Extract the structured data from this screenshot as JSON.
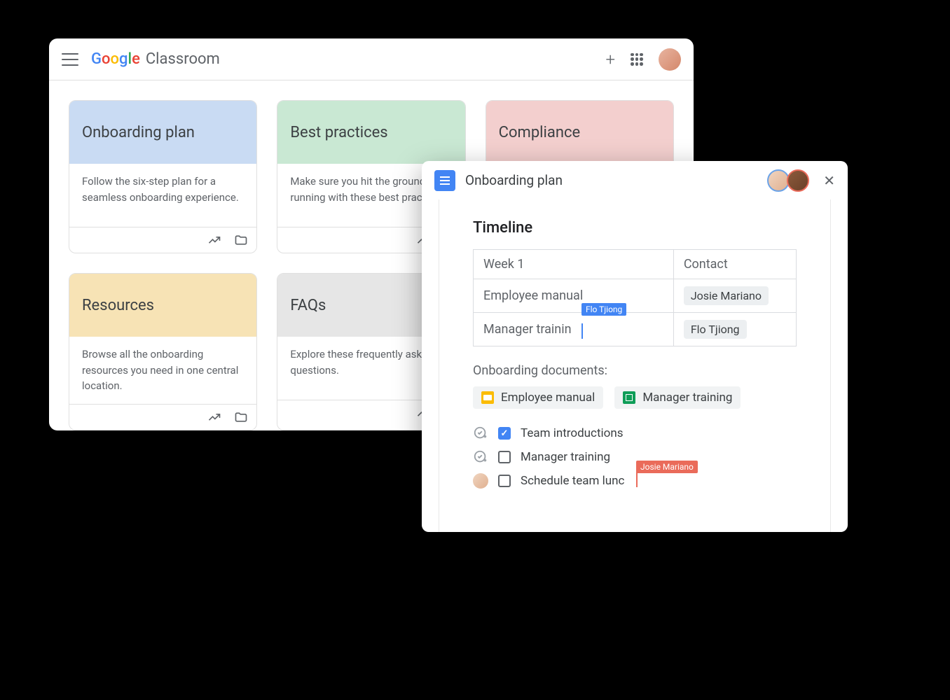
{
  "classroom": {
    "app_name": "Classroom",
    "cards": [
      {
        "title": "Onboarding plan",
        "desc": "Follow the six-step plan for a seamless onboarding experience.",
        "color": "c-blue"
      },
      {
        "title": "Best practices",
        "desc": "Make sure you hit the ground running with these best practices.",
        "color": "c-green"
      },
      {
        "title": "Compliance",
        "desc": "",
        "color": "c-pink"
      },
      {
        "title": "Resources",
        "desc": "Browse all the onboarding resources you need in one central location.",
        "color": "c-yellow"
      },
      {
        "title": "FAQs",
        "desc": "Explore these frequently asked questions.",
        "color": "c-gray"
      }
    ]
  },
  "docs": {
    "title": "Onboarding plan",
    "heading": "Timeline",
    "table": {
      "headers": [
        "Week 1",
        "Contact"
      ],
      "rows": [
        {
          "item": "Employee manual",
          "contact": "Josie Mariano"
        },
        {
          "item": "Manager trainin",
          "contact": "Flo Tjiong"
        }
      ]
    },
    "cursor_tags": {
      "blue": "Flo Tjiong",
      "red": "Josie Mariano"
    },
    "section_label": "Onboarding documents:",
    "doc_chips": [
      {
        "icon": "slides",
        "label": "Employee manual"
      },
      {
        "icon": "sheets",
        "label": "Manager training"
      }
    ],
    "checklist": [
      {
        "checked": true,
        "label": "Team introductions",
        "assignee": "icon"
      },
      {
        "checked": false,
        "label": "Manager training",
        "assignee": "icon"
      },
      {
        "checked": false,
        "label": "Schedule team lunc",
        "assignee": "avatar"
      }
    ]
  }
}
